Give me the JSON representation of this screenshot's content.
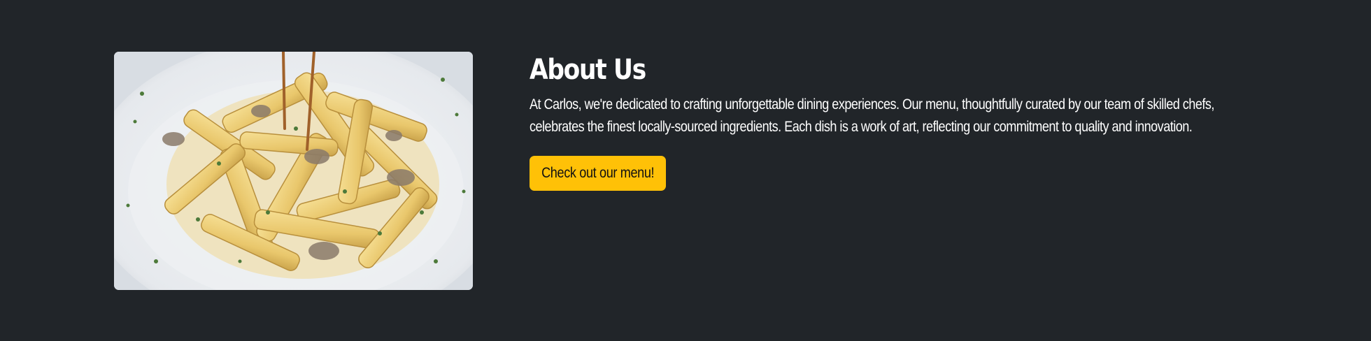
{
  "about": {
    "title": "About Us",
    "description": "At Carlos, we're dedicated to crafting unforgettable dining experiences. Our menu, thoughtfully curated by our team of skilled chefs, celebrates the finest locally-sourced ingredients. Each dish is a work of art, reflecting our commitment to quality and innovation.",
    "button_label": "Check out our menu!"
  },
  "colors": {
    "background": "#212529",
    "accent": "#ffc107",
    "text": "#ffffff"
  }
}
